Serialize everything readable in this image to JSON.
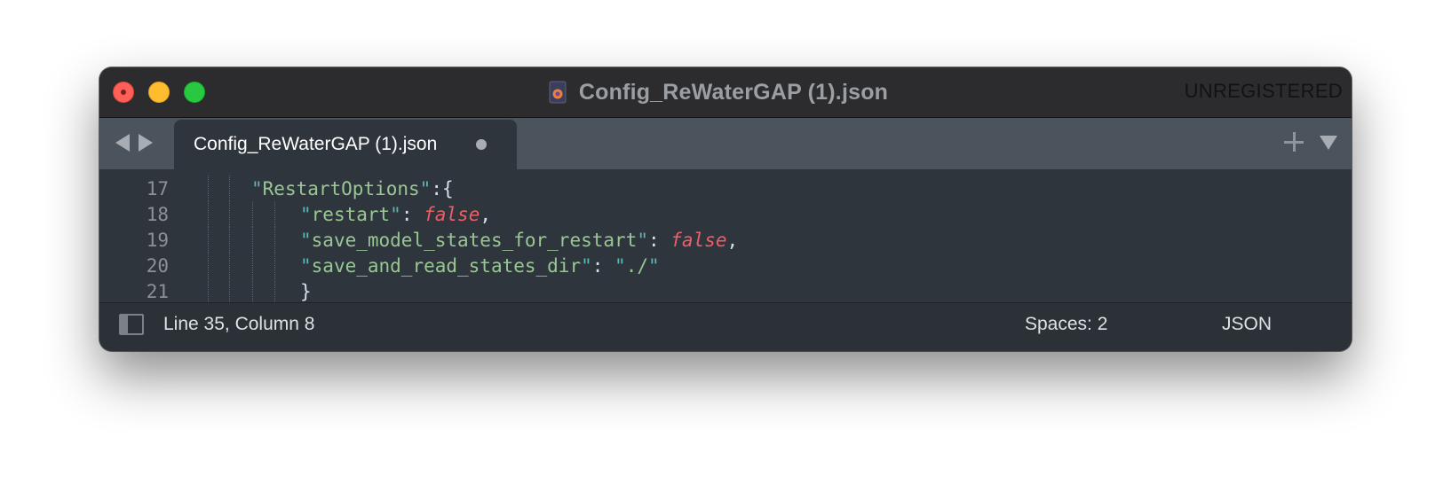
{
  "window": {
    "title": "Config_ReWaterGAP (1).json",
    "registration": "UNREGISTERED"
  },
  "tabs": [
    {
      "label": "Config_ReWaterGAP (1).json",
      "modified": true
    }
  ],
  "editor": {
    "lines": [
      {
        "number": "17",
        "tokens": [
          [
            "str-quote",
            "\""
          ],
          [
            "str-key",
            "RestartOptions"
          ],
          [
            "str-quote",
            "\""
          ],
          [
            "punct",
            ":{"
          ]
        ]
      },
      {
        "number": "18",
        "tokens": [
          [
            "str-quote",
            "\""
          ],
          [
            "str-key",
            "restart"
          ],
          [
            "str-quote",
            "\""
          ],
          [
            "punct",
            ": "
          ],
          [
            "bool",
            "false"
          ],
          [
            "punct",
            ","
          ]
        ]
      },
      {
        "number": "19",
        "tokens": [
          [
            "str-quote",
            "\""
          ],
          [
            "str-key",
            "save_model_states_for_restart"
          ],
          [
            "str-quote",
            "\""
          ],
          [
            "punct",
            ": "
          ],
          [
            "bool",
            "false"
          ],
          [
            "punct",
            ","
          ]
        ]
      },
      {
        "number": "20",
        "tokens": [
          [
            "str-quote",
            "\""
          ],
          [
            "str-key",
            "save_and_read_states_dir"
          ],
          [
            "str-quote",
            "\""
          ],
          [
            "punct",
            ": "
          ],
          [
            "str-quote",
            "\""
          ],
          [
            "str-key",
            "./"
          ],
          [
            "str-quote",
            "\""
          ]
        ]
      },
      {
        "number": "21",
        "tokens": [
          [
            "punct",
            "}"
          ]
        ]
      }
    ]
  },
  "statusbar": {
    "position": "Line 35, Column 8",
    "indentation": "Spaces: 2",
    "syntax": "JSON"
  },
  "colors": {
    "background": "#2f353d",
    "tabbar": "#4b535d",
    "string": "#99c794",
    "quote": "#5fb4b4",
    "boolean": "#ec5f67"
  },
  "icons": [
    "close-icon",
    "minimize-icon",
    "maximize-icon",
    "file-icon",
    "nav-back-icon",
    "nav-forward-icon",
    "new-tab-icon",
    "tab-menu-icon",
    "sidebar-toggle-icon",
    "unsaved-dot-icon"
  ]
}
